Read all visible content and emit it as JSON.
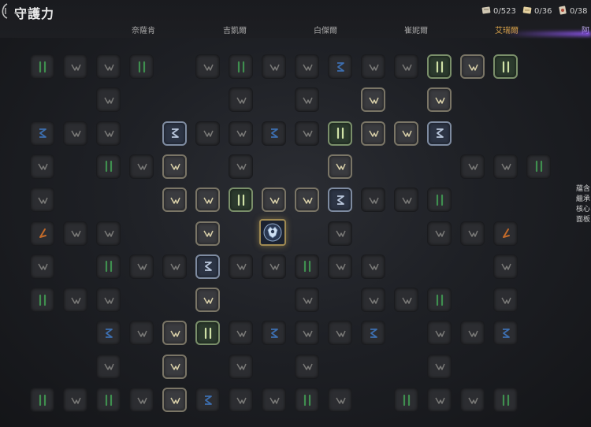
{
  "header": {
    "title": "守護力",
    "counters": [
      {
        "icon": "scroll-icon",
        "value": "0/523"
      },
      {
        "icon": "map-scroll-icon",
        "value": "0/36"
      },
      {
        "icon": "card-icon",
        "value": "0/38"
      }
    ]
  },
  "tabs": [
    {
      "label": "奈薩肯",
      "active": false
    },
    {
      "label": "吉凱爾",
      "active": false
    },
    {
      "label": "白傑爾",
      "active": false
    },
    {
      "label": "崔妮爾",
      "active": false
    },
    {
      "label": "艾瑞爾",
      "active": true
    },
    {
      "label": "阿",
      "active": false
    }
  ],
  "side_panel": [
    "蘊含",
    "繼承",
    "核心",
    "面板"
  ],
  "center_node": {
    "icon": "crest-icon"
  },
  "grid": {
    "cols": 16,
    "rows": 11,
    "nodes": [
      [
        [
          "g",
          0
        ],
        [
          "k",
          0
        ],
        [
          "k",
          0
        ],
        [
          "g",
          0
        ],
        null,
        [
          "k",
          0
        ],
        [
          "g",
          0
        ],
        [
          "k",
          0
        ],
        [
          "k",
          0
        ],
        [
          "b",
          0
        ],
        [
          "k",
          0
        ],
        [
          "k",
          0
        ],
        [
          "g",
          1
        ],
        [
          "k",
          1
        ],
        [
          "g",
          1
        ],
        null
      ],
      [
        null,
        null,
        [
          "k",
          0
        ],
        null,
        null,
        null,
        [
          "k",
          0
        ],
        null,
        [
          "k",
          0
        ],
        null,
        [
          "k",
          1
        ],
        null,
        [
          "k",
          1
        ],
        null,
        null,
        null
      ],
      [
        [
          "b",
          0
        ],
        [
          "k",
          0
        ],
        [
          "k",
          0
        ],
        null,
        [
          "b",
          1
        ],
        [
          "k",
          0
        ],
        [
          "k",
          0
        ],
        [
          "b",
          0
        ],
        [
          "k",
          0
        ],
        [
          "g",
          1
        ],
        [
          "k",
          1
        ],
        [
          "k",
          1
        ],
        [
          "b",
          1
        ],
        null,
        null,
        null
      ],
      [
        [
          "k",
          0
        ],
        null,
        [
          "g",
          0
        ],
        [
          "k",
          0
        ],
        [
          "k",
          1
        ],
        null,
        [
          "k",
          0
        ],
        null,
        null,
        [
          "k",
          1
        ],
        null,
        null,
        null,
        [
          "k",
          0
        ],
        [
          "k",
          0
        ],
        [
          "g",
          0
        ]
      ],
      [
        [
          "k",
          0
        ],
        null,
        null,
        null,
        [
          "k",
          1
        ],
        [
          "k",
          1
        ],
        [
          "g",
          1
        ],
        [
          "k",
          1
        ],
        [
          "k",
          1
        ],
        [
          "b",
          1
        ],
        [
          "k",
          0
        ],
        [
          "k",
          0
        ],
        [
          "g",
          0
        ],
        null,
        null,
        null
      ],
      [
        [
          "o",
          0
        ],
        [
          "k",
          0
        ],
        [
          "k",
          0
        ],
        null,
        null,
        [
          "k",
          1
        ],
        null,
        null,
        null,
        [
          "k",
          0
        ],
        null,
        null,
        [
          "k",
          0
        ],
        [
          "k",
          0
        ],
        [
          "o",
          0
        ],
        null
      ],
      [
        [
          "k",
          0
        ],
        null,
        [
          "g",
          0
        ],
        [
          "k",
          0
        ],
        [
          "k",
          0
        ],
        [
          "b",
          1
        ],
        [
          "k",
          0
        ],
        [
          "k",
          0
        ],
        [
          "g",
          0
        ],
        [
          "k",
          0
        ],
        [
          "k",
          0
        ],
        null,
        null,
        null,
        [
          "k",
          0
        ],
        null
      ],
      [
        [
          "g",
          0
        ],
        [
          "k",
          0
        ],
        [
          "k",
          0
        ],
        null,
        null,
        [
          "k",
          1
        ],
        null,
        null,
        [
          "k",
          0
        ],
        null,
        [
          "k",
          0
        ],
        [
          "k",
          0
        ],
        [
          "g",
          0
        ],
        null,
        [
          "k",
          0
        ],
        null
      ],
      [
        null,
        null,
        [
          "b",
          0
        ],
        [
          "k",
          0
        ],
        [
          "k",
          1
        ],
        [
          "g",
          1
        ],
        [
          "k",
          0
        ],
        [
          "b",
          0
        ],
        [
          "k",
          0
        ],
        [
          "k",
          0
        ],
        [
          "b",
          0
        ],
        null,
        [
          "k",
          0
        ],
        [
          "k",
          0
        ],
        [
          "b",
          0
        ],
        null
      ],
      [
        null,
        null,
        [
          "k",
          0
        ],
        null,
        [
          "k",
          1
        ],
        null,
        [
          "k",
          0
        ],
        null,
        [
          "k",
          0
        ],
        null,
        null,
        null,
        [
          "k",
          0
        ],
        null,
        null,
        null
      ],
      [
        [
          "g",
          0
        ],
        [
          "k",
          0
        ],
        [
          "g",
          0
        ],
        [
          "k",
          0
        ],
        [
          "k",
          1
        ],
        [
          "b",
          0
        ],
        [
          "k",
          0
        ],
        [
          "k",
          0
        ],
        [
          "g",
          0
        ],
        [
          "k",
          0
        ],
        null,
        [
          "g",
          0
        ],
        [
          "k",
          0
        ],
        [
          "k",
          0
        ],
        [
          "g",
          0
        ],
        null
      ]
    ]
  }
}
